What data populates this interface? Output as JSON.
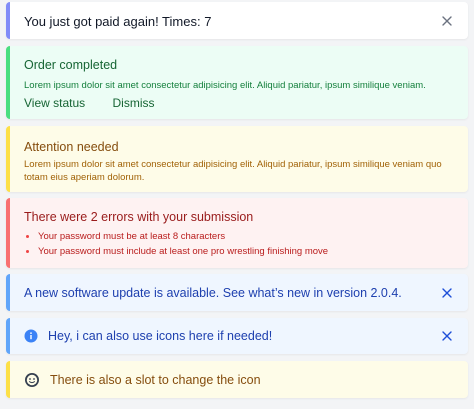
{
  "alerts": {
    "paid": {
      "title": "You just got paid again! Times: 7",
      "icon": "close-icon"
    },
    "success": {
      "title": "Order completed",
      "body": "Lorem ipsum dolor sit amet consectetur adipisicing elit. Aliquid pariatur, ipsum similique veniam.",
      "view_label": "View status",
      "dismiss_label": "Dismiss"
    },
    "warning": {
      "title": "Attention needed",
      "body": "Lorem ipsum dolor sit amet consectetur adipisicing elit. Aliquid pariatur, ipsum similique veniam quo totam eius aperiam dolorum."
    },
    "error": {
      "title": "There were 2 errors with your submission",
      "items": [
        "Your password must be at least 8 characters",
        "Your password must include at least one pro wrestling finishing move"
      ]
    },
    "update": {
      "title": "A new software update is available. See what’s new in version 2.0.4.",
      "icon": "close-icon"
    },
    "info_icon": {
      "title": "Hey, i can also use icons here if needed!",
      "lead_icon": "info-icon",
      "icon": "close-icon"
    },
    "custom_icon": {
      "title": "There is also a slot to change the icon",
      "lead_icon": "face-icon"
    }
  },
  "colors": {
    "indigo": "#818cf8",
    "green": "#4ade80",
    "yellow": "#fde047",
    "red": "#f87171",
    "blue": "#60a5fa"
  }
}
